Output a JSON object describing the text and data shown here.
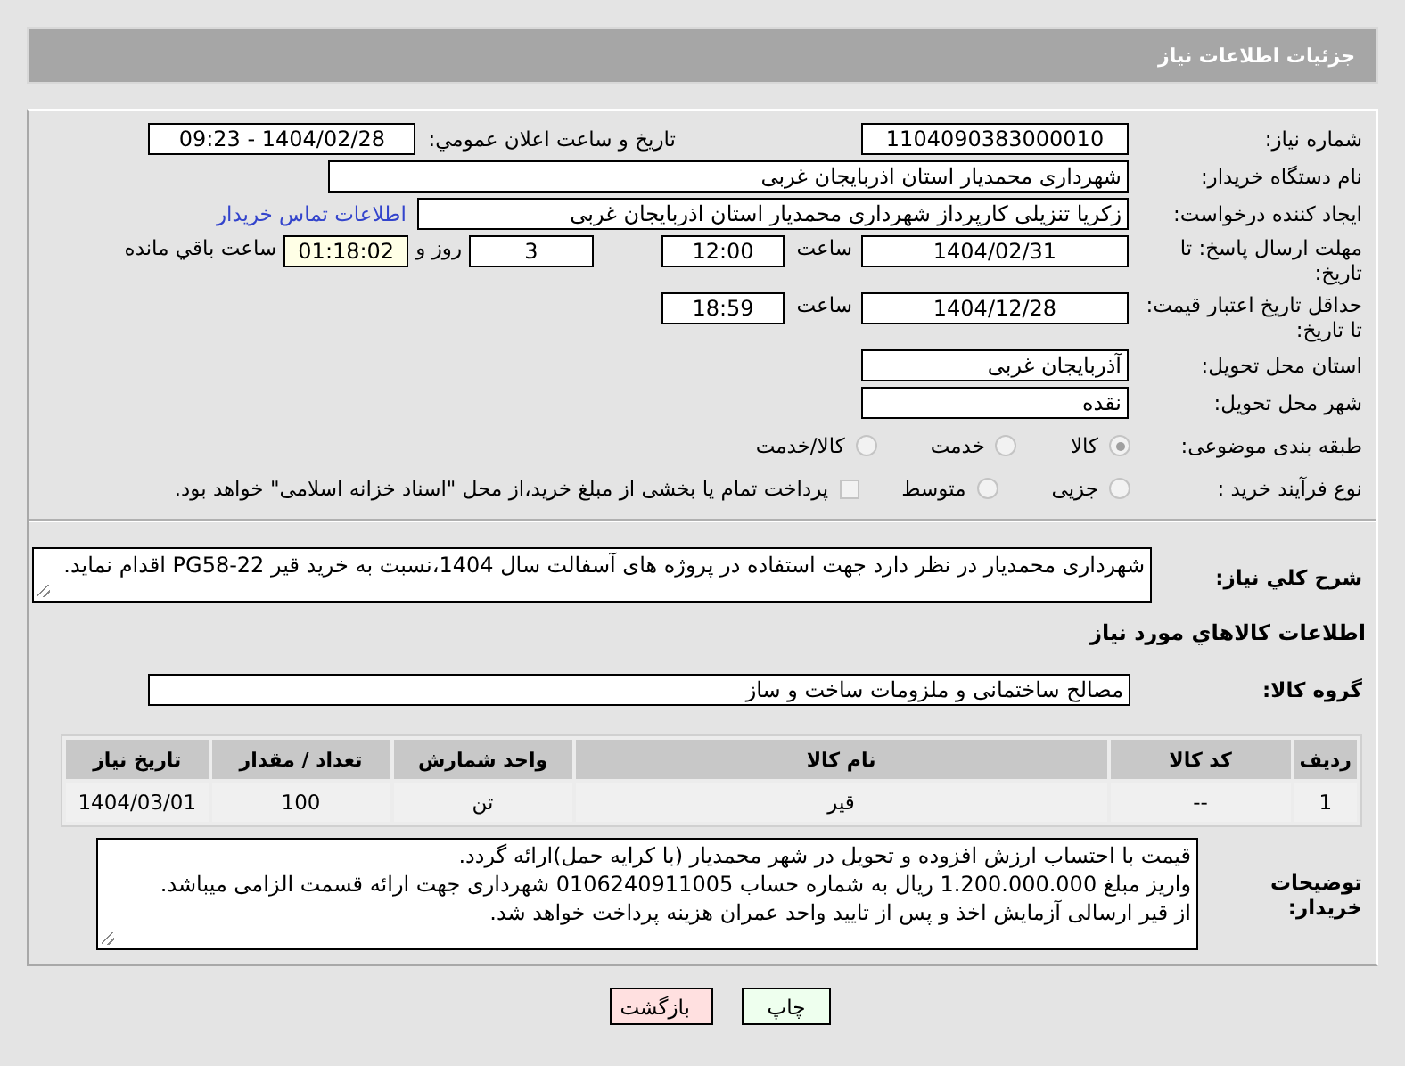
{
  "page_title": "جزئیات اطلاعات نیاز",
  "need_number": {
    "label": "شماره نیاز:",
    "value": "1104090383000010"
  },
  "announce": {
    "label": "تاریخ و ساعت اعلان عمومي:",
    "value": "1404/02/28 - 09:23"
  },
  "buyer_org": {
    "label": "نام دستگاه خریدار:",
    "value": "شهرداری محمدیار استان اذربایجان غربی"
  },
  "creator": {
    "label": "ایجاد کننده درخواست:",
    "value": "زکریا تنزیلی کارپرداز شهرداری محمدیار استان اذربایجان غربی",
    "link": "اطلاعات تماس خریدار"
  },
  "deadline": {
    "label": "مهلت ارسال پاسخ: تا تاریخ:",
    "date": "1404/02/31",
    "time_label": "ساعت",
    "time": "12:00",
    "days": "3",
    "days_label": "روز و",
    "remaining": "01:18:02",
    "remaining_label": "ساعت باقي مانده"
  },
  "validity": {
    "label": "حداقل تاریخ اعتبار قیمت: تا تاریخ:",
    "date": "1404/12/28",
    "time_label": "ساعت",
    "time": "18:59"
  },
  "province": {
    "label": "استان محل تحویل:",
    "value": "آذربایجان غربی"
  },
  "city": {
    "label": "شهر محل تحویل:",
    "value": "نقده"
  },
  "category": {
    "label": "طبقه بندی موضوعی:",
    "options": [
      {
        "label": "کالا",
        "selected": true
      },
      {
        "label": "خدمت",
        "selected": false
      },
      {
        "label": "کالا/خدمت",
        "selected": false
      }
    ]
  },
  "process": {
    "label": "نوع فرآیند خرید :",
    "options": [
      {
        "label": "جزیی",
        "selected": false
      },
      {
        "label": "متوسط",
        "selected": false
      }
    ],
    "treasury": {
      "label": "پرداخت تمام یا بخشی از مبلغ خرید،از محل \"اسناد خزانه اسلامی\" خواهد بود.",
      "checked": false
    }
  },
  "description": {
    "label": "شرح کلي نیاز:",
    "value": "شهرداری محمدیار در نظر دارد جهت استفاده در پروژه های آسفالت سال 1404،نسبت به خرید قیر PG58-22 اقدام نماید."
  },
  "goods_heading": "اطلاعات کالاهاي مورد نیاز",
  "goods_group": {
    "label": "گروه کالا:",
    "value": "مصالح ساختمانی و ملزومات ساخت و ساز"
  },
  "table": {
    "columns": [
      "ردیف",
      "کد کالا",
      "نام کالا",
      "واحد شمارش",
      "تعداد / مقدار",
      "تاریخ نیاز"
    ],
    "rows": [
      [
        "1",
        "--",
        "قیر",
        "تن",
        "100",
        "1404/03/01"
      ]
    ]
  },
  "buyer_notes": {
    "label": "توضیحات خریدار:",
    "lines": [
      "قیمت با احتساب ارزش افزوده و تحویل در شهر محمدیار (با کرایه حمل)ارائه گردد.",
      "واریز مبلغ 1.200.000.000 ریال به شماره حساب 0106240911005 شهرداری جهت ارائه قسمت الزامی میباشد.",
      "از قیر ارسالی آزمایش اخذ و پس از تایید واحد عمران هزینه پرداخت خواهد شد."
    ]
  },
  "buttons": [
    {
      "label": "چاپ",
      "kind": "print"
    },
    {
      "label": "بازگشت",
      "kind": "back"
    }
  ]
}
